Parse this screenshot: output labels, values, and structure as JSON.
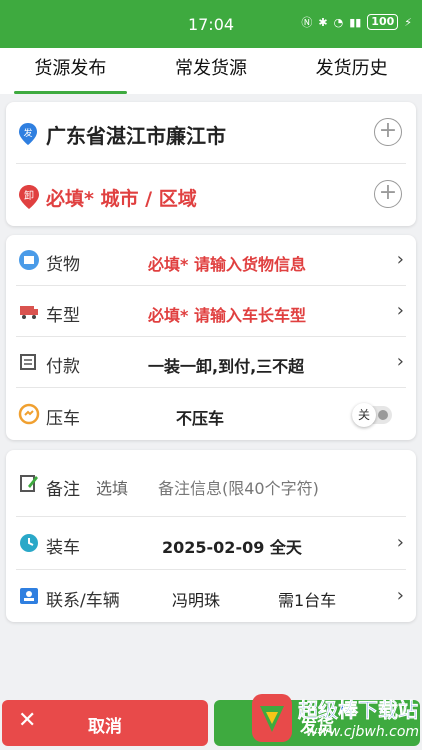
{
  "status_bar": {
    "time": "17:04",
    "battery": "100"
  },
  "tabs": [
    {
      "label": "货源发布",
      "active": true
    },
    {
      "label": "常发货源",
      "active": false
    },
    {
      "label": "发货历史",
      "active": false
    }
  ],
  "address": {
    "origin": "广东省湛江市廉江市",
    "origin_badge": "发",
    "destination": "必填* 城市 / 区域",
    "destination_badge": "卸"
  },
  "cargo": {
    "goods": {
      "label": "货物",
      "value": "必填* 请输入货物信息"
    },
    "vehicle_type": {
      "label": "车型",
      "value": "必填* 请输入车长车型"
    },
    "payment": {
      "label": "付款",
      "value": "一装一卸,到付,三不超"
    },
    "press_vehicle": {
      "label": "压车",
      "value": "不压车",
      "toggle_label": "关",
      "toggle_on": false
    }
  },
  "extra": {
    "remark": {
      "label": "备注",
      "optional": "选填",
      "placeholder": "备注信息(限40个字符)"
    },
    "loading": {
      "label": "装车",
      "value": "2025-02-09 全天"
    },
    "contact": {
      "label": "联系/车辆",
      "name": "冯明珠",
      "vehicles": "需1台车"
    }
  },
  "buttons": {
    "cancel": "取消",
    "confirm": "发货"
  },
  "watermark": {
    "text": "超级棒下载站",
    "url": "www.cjbwh.com"
  },
  "colors": {
    "accent": "#3eaa3f",
    "danger": "#e84a4a",
    "required": "#e04040"
  },
  "icons": [
    "wifi-icon",
    "bluetooth-icon",
    "signal-icon",
    "battery-icon",
    "origin-pin-icon",
    "destination-pin-icon",
    "plus-circle-icon",
    "cargo-icon",
    "truck-icon",
    "payment-icon",
    "press-icon",
    "edit-icon",
    "clock-icon",
    "contact-icon",
    "chevron-right-icon",
    "close-icon"
  ]
}
